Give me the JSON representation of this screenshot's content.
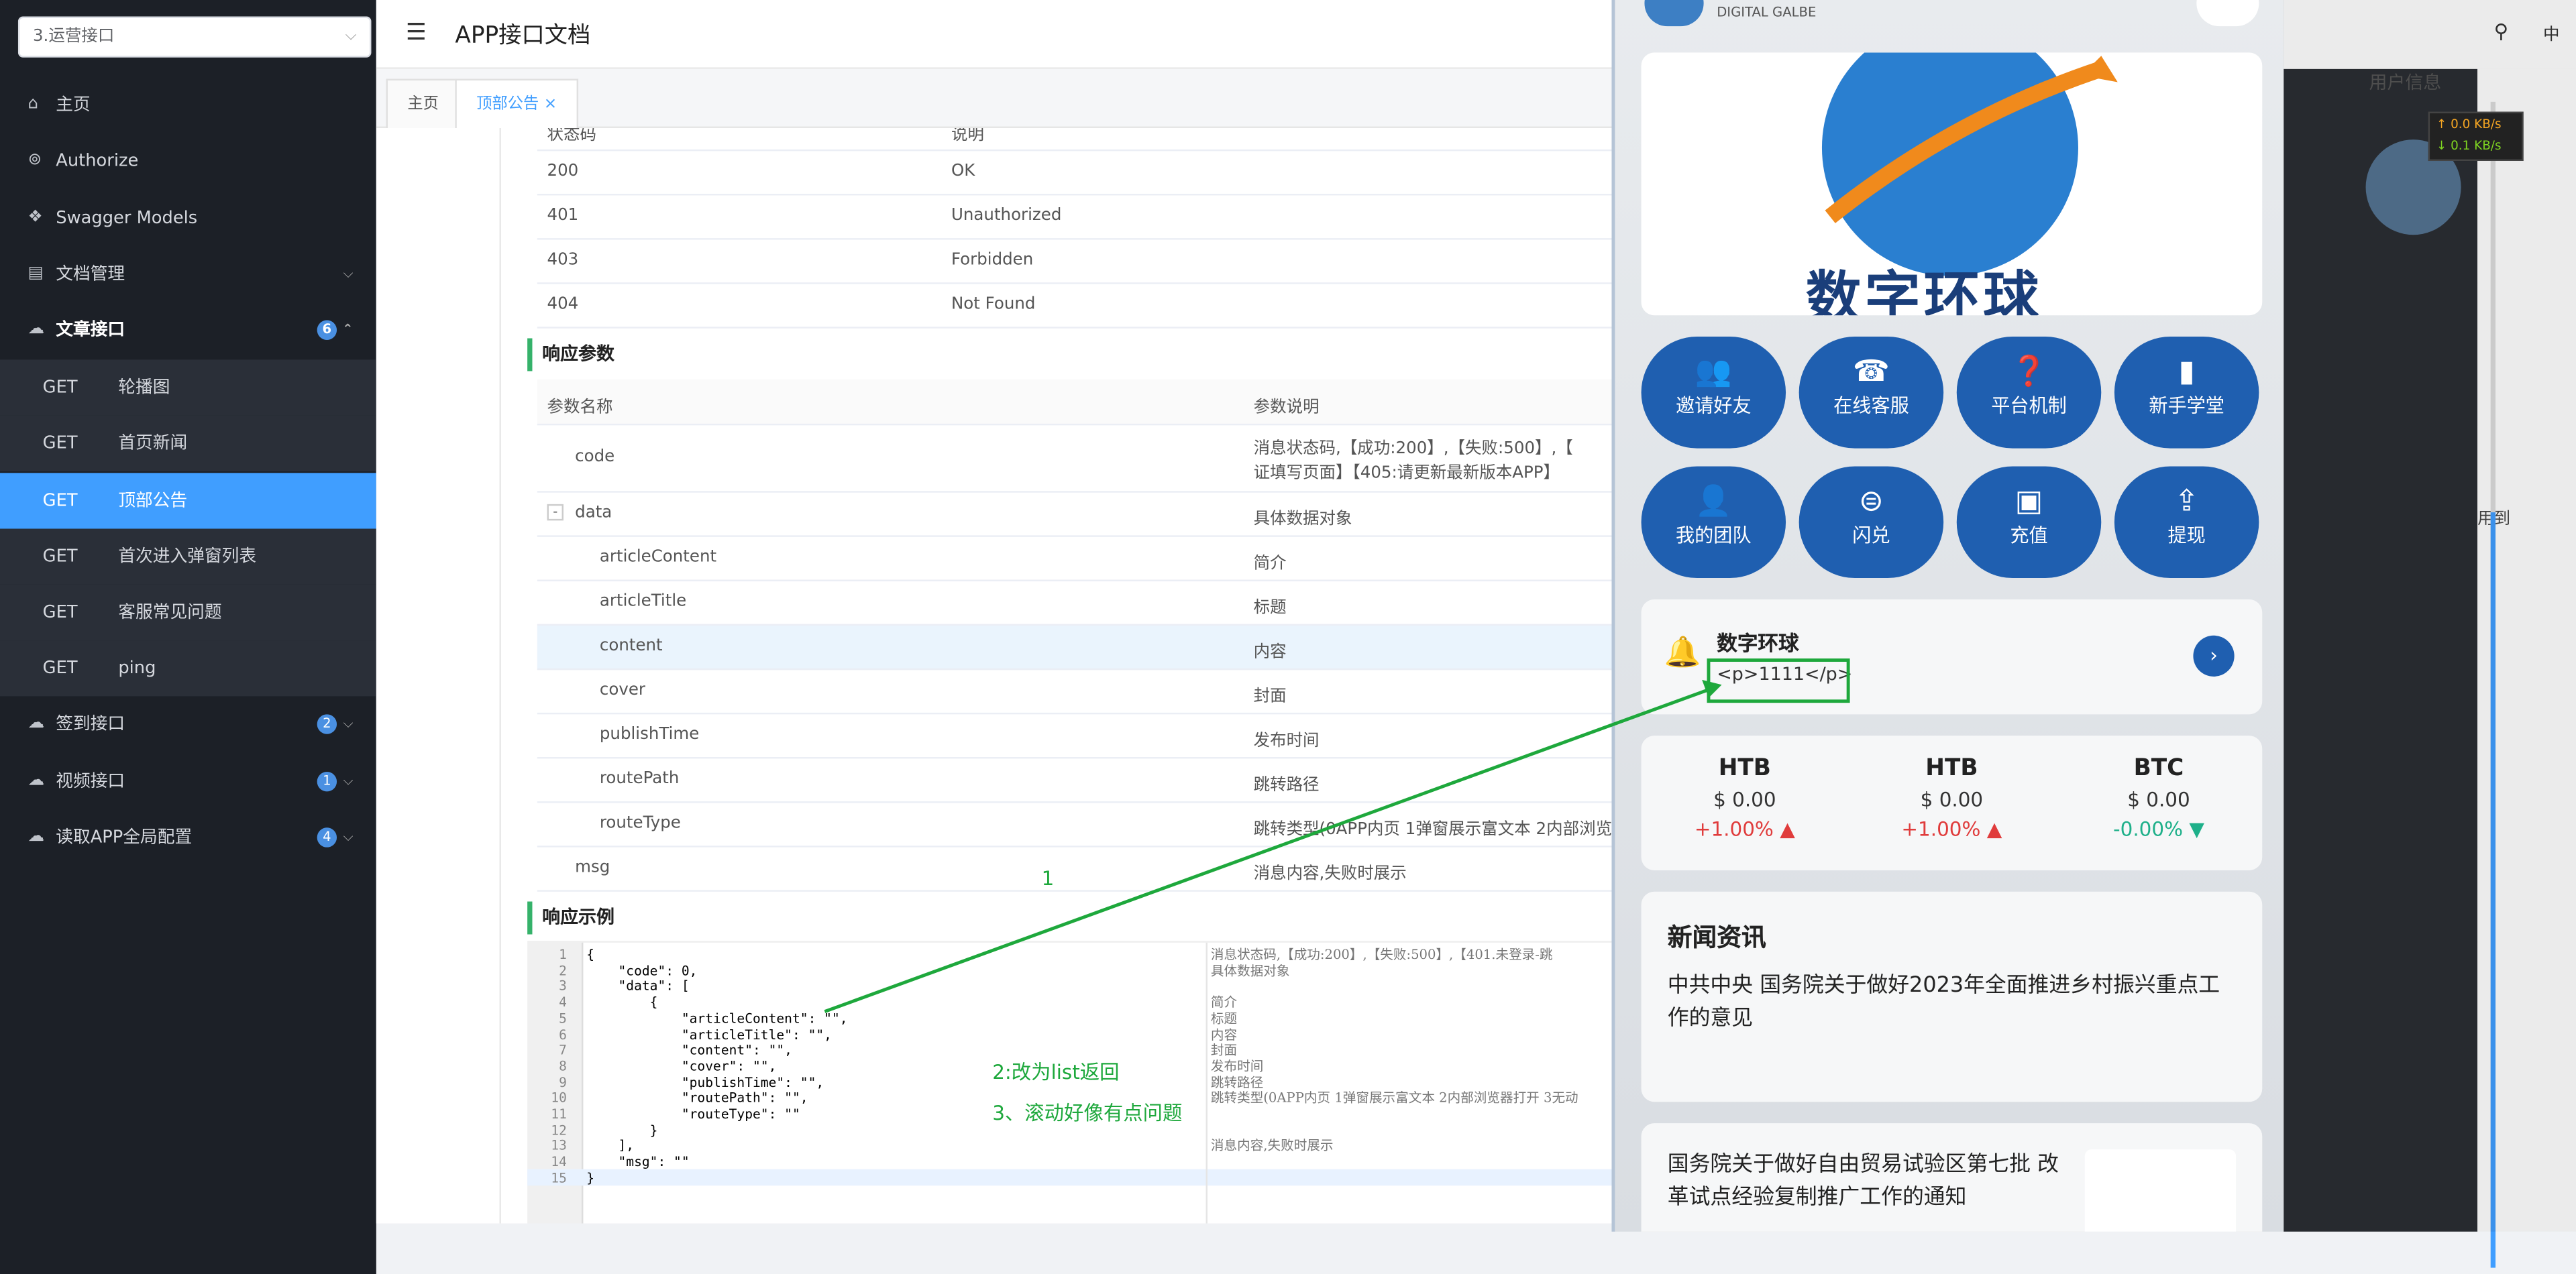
{
  "app": {
    "project_select": "3.运营接口",
    "page_title": "APP接口文档"
  },
  "sidebar": {
    "items": [
      {
        "label": "主页",
        "icon": "home-icon"
      },
      {
        "label": "Authorize",
        "icon": "lock-icon"
      },
      {
        "label": "Swagger Models",
        "icon": "cube-icon"
      },
      {
        "label": "文档管理",
        "icon": "doc-icon"
      },
      {
        "label": "文章接口",
        "icon": "cloud-icon",
        "badge": "6"
      },
      {
        "label": "签到接口",
        "icon": "cloud-icon",
        "badge": "2"
      },
      {
        "label": "视频接口",
        "icon": "cloud-icon",
        "badge": "1"
      },
      {
        "label": "读取APP全局配置",
        "icon": "cloud-icon",
        "badge": "4"
      }
    ],
    "sub": [
      {
        "method": "GET",
        "name": "轮播图"
      },
      {
        "method": "GET",
        "name": "首页新闻"
      },
      {
        "method": "GET",
        "name": "顶部公告"
      },
      {
        "method": "GET",
        "name": "首次进入弹窗列表"
      },
      {
        "method": "GET",
        "name": "客服常见问题"
      },
      {
        "method": "GET",
        "name": "ping"
      }
    ]
  },
  "tabs": [
    "主页",
    "顶部公告"
  ],
  "status": {
    "h1": "状态码",
    "h2": "说明",
    "rows": [
      [
        "200",
        "OK"
      ],
      [
        "401",
        "Unauthorized"
      ],
      [
        "403",
        "Forbidden"
      ],
      [
        "404",
        "Not Found"
      ]
    ]
  },
  "resp_params": {
    "title": "响应参数",
    "h1": "参数名称",
    "h2": "参数说明",
    "code": "code",
    "code_desc1": "消息状态码,【成功:200】,【失败:500】,【",
    "code_desc2": "证填写页面】【405:请更新最新版本APP】",
    "data": "data",
    "data_desc": "具体数据对象",
    "fields": [
      [
        "articleContent",
        "简介"
      ],
      [
        "articleTitle",
        "标题"
      ],
      [
        "content",
        "内容"
      ],
      [
        "cover",
        "封面"
      ],
      [
        "publishTime",
        "发布时间"
      ],
      [
        "routePath",
        "跳转路径"
      ],
      [
        "routeType",
        "跳转类型(0APP内页 1弹窗展示富文本 2内部浏览"
      ]
    ],
    "msg": "msg",
    "msg_desc": "消息内容,失败时展示"
  },
  "example": {
    "title": "响应示例",
    "lines": [
      "{",
      "    \"code\": 0,",
      "    \"data\": [",
      "        {",
      "            \"articleContent\": \"\",",
      "            \"articleTitle\": \"\",",
      "            \"content\": \"\",",
      "            \"cover\": \"\",",
      "            \"publishTime\": \"\",",
      "            \"routePath\": \"\",",
      "            \"routeType\": \"\"",
      "        }",
      "    ],",
      "    \"msg\": \"\"",
      "}"
    ],
    "comments": [
      "消息状态码,【成功:200】,【失败:500】,【401.未登录-跳",
      "具体数据对象",
      "",
      "简介",
      "标题",
      "内容",
      "封面",
      "发布时间",
      "跳转路径",
      "跳转类型(0APP内页 1弹窗展示富文本 2内部浏览器打开 3无动",
      "",
      "",
      "消息内容,失败时展示"
    ]
  },
  "annotations": {
    "a1": "1",
    "a2": "2:改为list返回",
    "a3": "3、滚动好像有点问题"
  },
  "phone": {
    "brand": "DIGITAL GALBE",
    "banner_text": "数字环球",
    "buttons": [
      "邀请好友",
      "在线客服",
      "平台机制",
      "新手学堂",
      "我的团队",
      "闪兑",
      "充值",
      "提现"
    ],
    "notice_title": "数字环球",
    "notice_body": "<p>1111</p>",
    "coins": [
      {
        "sym": "HTB",
        "price": "$ 0.00",
        "chg": "+1.00%"
      },
      {
        "sym": "HTB",
        "price": "$ 0.00",
        "chg": "+1.00%"
      },
      {
        "sym": "BTC",
        "price": "$ 0.00",
        "chg": "-0.00%"
      }
    ],
    "news_title": "新闻资讯",
    "news1": "中共中央 国务院关于做好2023年全面推进乡村振兴重点工作的意见",
    "news2": "国务院关于做好自由贸易试验区第七批 改革试点经验复制推广工作的通知"
  },
  "right": {
    "user": "用户信息",
    "speed_up": "↑ 0.0 KB/s",
    "speed_down": "↓ 0.1 KB/s",
    "lang": "中",
    "side_text": "用到"
  }
}
